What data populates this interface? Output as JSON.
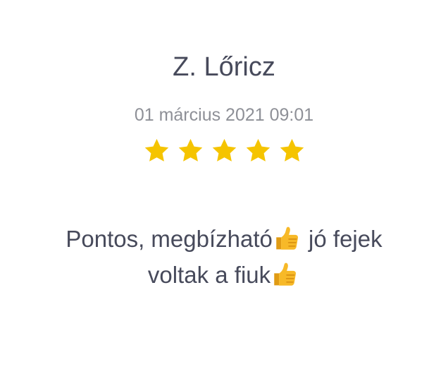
{
  "review": {
    "name": "Z. Lőricz",
    "date": "01 március 2021 09:01",
    "rating": 5,
    "rating_max": 5,
    "text_line1": "Pontos, megbízható",
    "text_line1_after": " jó fejek",
    "text_line2": "voltak a fiuk",
    "emoji_icon": "thumbs-up-icon"
  },
  "colors": {
    "text": "#474a5b",
    "muted": "#8e9097",
    "star": "#f5c400",
    "thumb": "#f7b928"
  }
}
